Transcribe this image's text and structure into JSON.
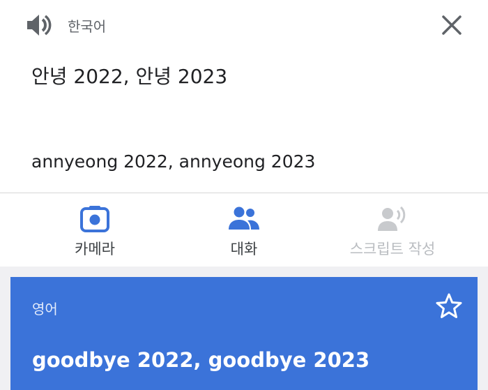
{
  "source": {
    "language": "한국어",
    "text": "안녕 2022, 안녕 2023",
    "romanization": "annyeong 2022, annyeong 2023",
    "speaker_icon": "speaker-icon",
    "close_icon": "close-icon"
  },
  "toolbar": {
    "camera_label": "카메라",
    "conversation_label": "대화",
    "transcribe_label": "스크립트 작성",
    "transcribe_enabled": false
  },
  "result": {
    "language": "영어",
    "text": "goodbye 2022, goodbye 2023",
    "star_icon": "star-outline-icon"
  },
  "colors": {
    "accent": "#3b73d9",
    "icon_gray": "#5f6368",
    "disabled_gray": "#c8cacd"
  }
}
